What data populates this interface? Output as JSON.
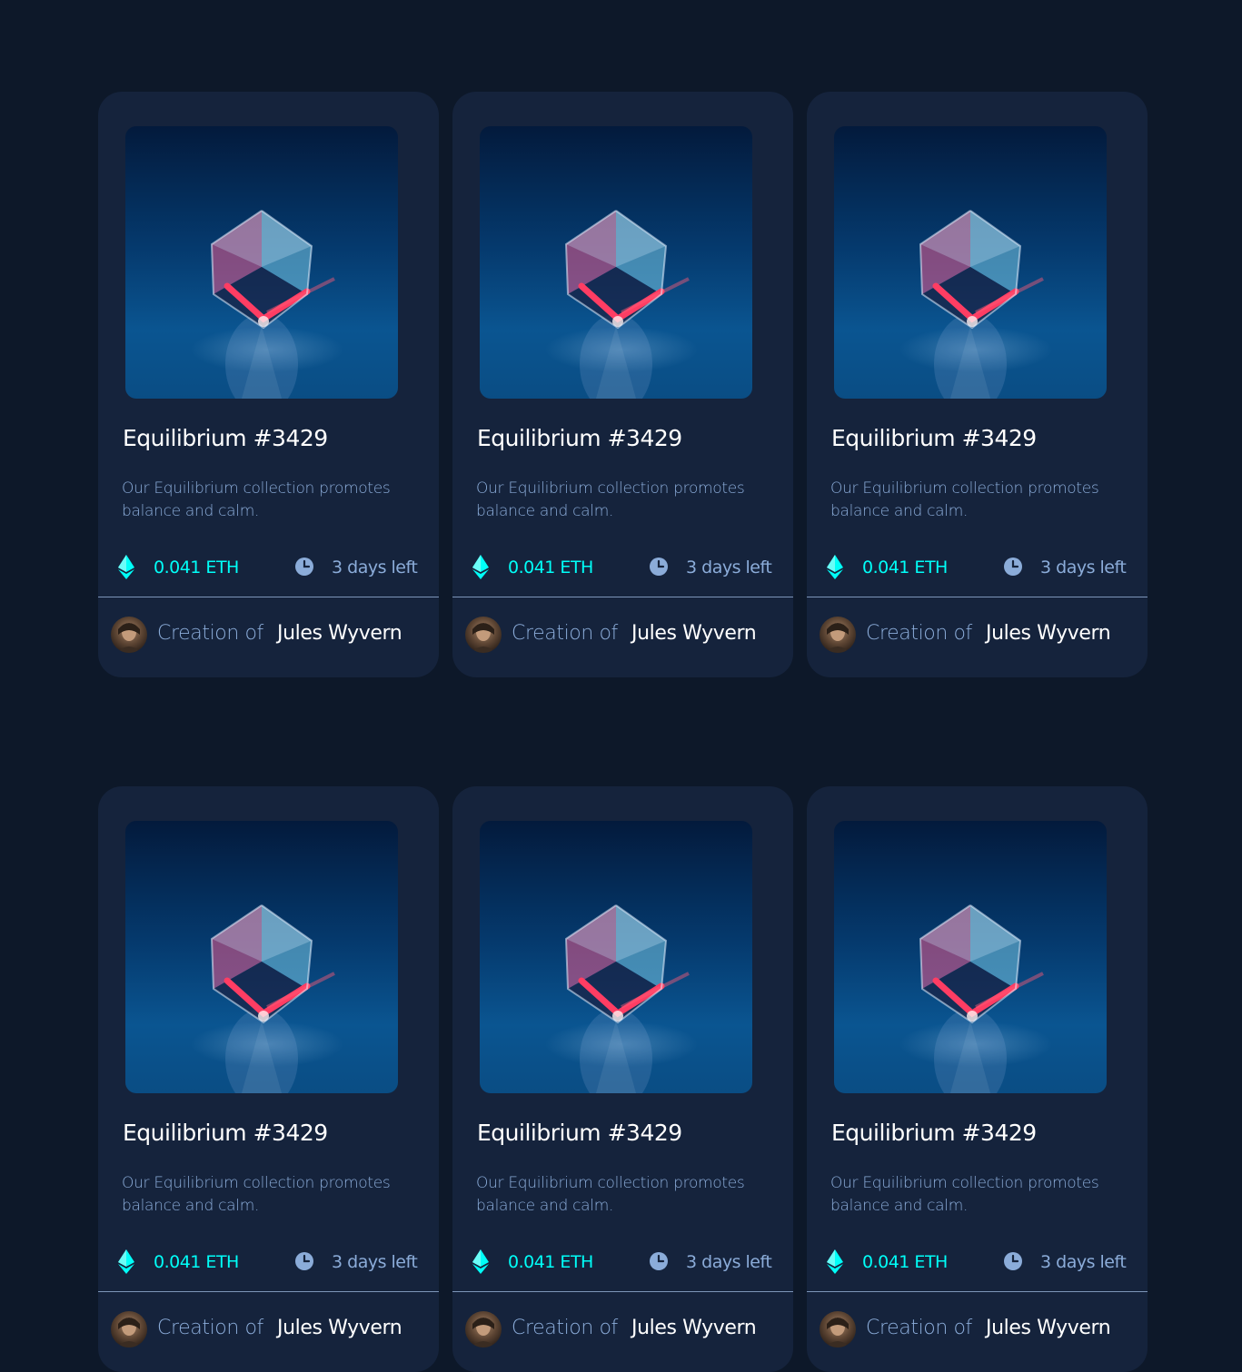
{
  "colors": {
    "page_background": "#0d1829",
    "card_background": "#15233c",
    "accent_cyan": "#00fff8",
    "soft_blue": "#8bacd9",
    "white": "#ffffff"
  },
  "cards": [
    {
      "title": "Equilibrium #3429",
      "description": "Our Equilibrium collection promotes balance and calm.",
      "price": "0.041 ETH",
      "time_left": "3 days left",
      "creator_prefix": "Creation of",
      "creator_name": "Jules Wyvern",
      "price_icon": "ethereum-icon",
      "time_icon": "clock-icon"
    },
    {
      "title": "Equilibrium #3429",
      "description": "Our Equilibrium collection promotes balance and calm.",
      "price": "0.041 ETH",
      "time_left": "3 days left",
      "creator_prefix": "Creation of",
      "creator_name": "Jules Wyvern",
      "price_icon": "ethereum-icon",
      "time_icon": "clock-icon"
    },
    {
      "title": "Equilibrium #3429",
      "description": "Our Equilibrium collection promotes balance and calm.",
      "price": "0.041 ETH",
      "time_left": "3 days left",
      "creator_prefix": "Creation of",
      "creator_name": "Jules Wyvern",
      "price_icon": "ethereum-icon",
      "time_icon": "clock-icon"
    },
    {
      "title": "Equilibrium #3429",
      "description": "Our Equilibrium collection promotes balance and calm.",
      "price": "0.041 ETH",
      "time_left": "3 days left",
      "creator_prefix": "Creation of",
      "creator_name": "Jules Wyvern",
      "price_icon": "ethereum-icon",
      "time_icon": "clock-icon"
    },
    {
      "title": "Equilibrium #3429",
      "description": "Our Equilibrium collection promotes balance and calm.",
      "price": "0.041 ETH",
      "time_left": "3 days left",
      "creator_prefix": "Creation of",
      "creator_name": "Jules Wyvern",
      "price_icon": "ethereum-icon",
      "time_icon": "clock-icon"
    },
    {
      "title": "Equilibrium #3429",
      "description": "Our Equilibrium collection promotes balance and calm.",
      "price": "0.041 ETH",
      "time_left": "3 days left",
      "creator_prefix": "Creation of",
      "creator_name": "Jules Wyvern",
      "price_icon": "ethereum-icon",
      "time_icon": "clock-icon"
    }
  ]
}
